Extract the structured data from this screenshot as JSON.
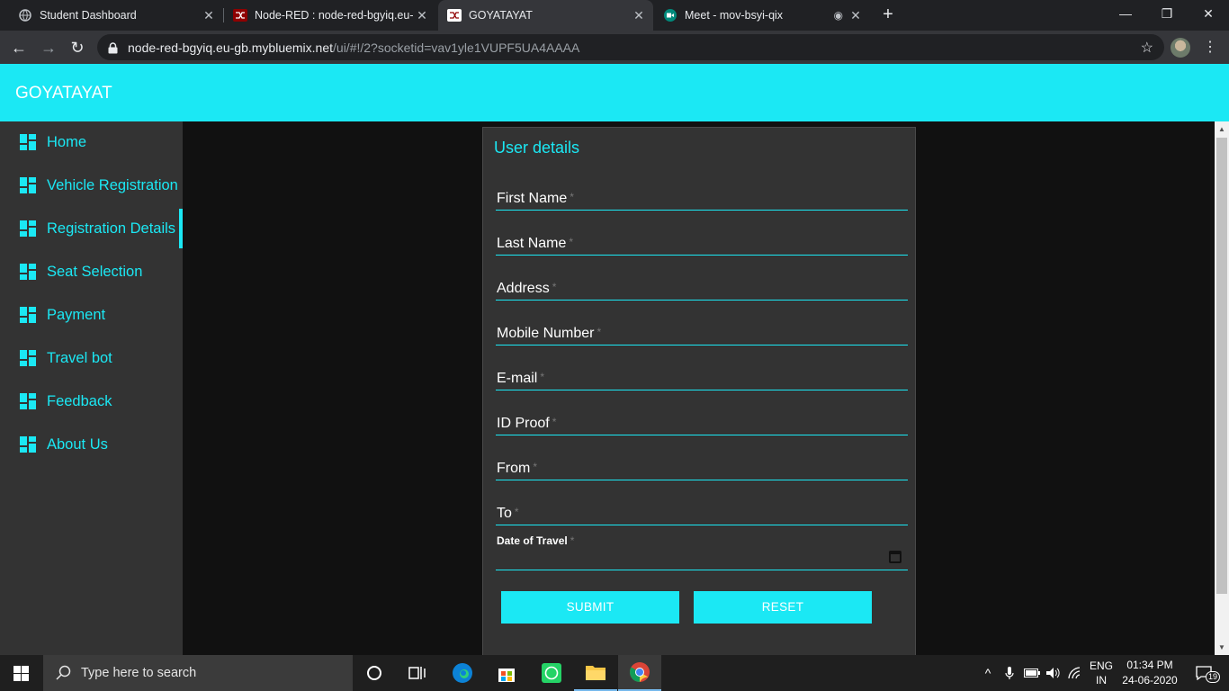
{
  "browser": {
    "tabs": [
      {
        "title": "Student Dashboard",
        "icon": "globe-icon"
      },
      {
        "title": "Node-RED : node-red-bgyiq.eu-g",
        "icon": "node-red-icon"
      },
      {
        "title": "GOYATAYAT",
        "icon": "node-red-icon",
        "active": true
      },
      {
        "title": "Meet - mov-bsyi-qix",
        "icon": "meet-icon",
        "recording": true
      }
    ],
    "new_tab": "+",
    "window_controls": {
      "minimize": "—",
      "restore": "❐",
      "close": "✕"
    },
    "url_host": "node-red-bgyiq.eu-gb.mybluemix.net",
    "url_path": "/ui/#!/2?socketid=vav1yle1VUPF5UA4AAAA"
  },
  "app": {
    "title": "GOYATAYAT",
    "accent": "#1be8f4",
    "nav": [
      {
        "label": "Home"
      },
      {
        "label": "Vehicle Registration"
      },
      {
        "label": "Registration Details",
        "active": true
      },
      {
        "label": "Seat Selection"
      },
      {
        "label": "Payment"
      },
      {
        "label": "Travel bot"
      },
      {
        "label": "Feedback"
      },
      {
        "label": "About Us"
      }
    ],
    "form": {
      "title": "User details",
      "fields": [
        {
          "label": "First Name"
        },
        {
          "label": "Last Name"
        },
        {
          "label": "Address"
        },
        {
          "label": "Mobile Number"
        },
        {
          "label": "E-mail"
        },
        {
          "label": "ID Proof"
        },
        {
          "label": "From"
        },
        {
          "label": "To"
        }
      ],
      "required_mark": "*",
      "date_label": "Date of Travel",
      "submit_label": "SUBMIT",
      "reset_label": "RESET"
    }
  },
  "taskbar": {
    "search_placeholder": "Type here to search",
    "lang_top": "ENG",
    "lang_bottom": "IN",
    "time": "01:34 PM",
    "date": "24-06-2020",
    "notifications": "19"
  }
}
